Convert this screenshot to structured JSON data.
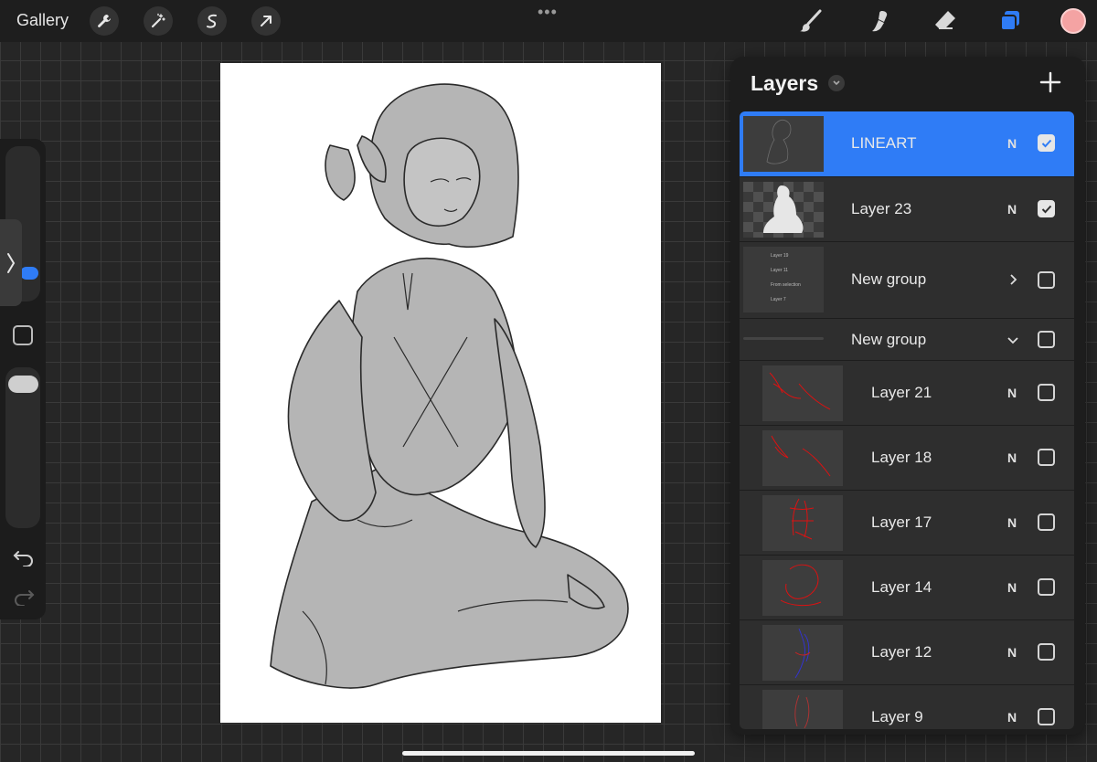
{
  "topbar": {
    "gallery_label": "Gallery",
    "left_tools": [
      "wrench-icon",
      "magic-wand-icon",
      "selection-icon",
      "transform-arrow-icon"
    ],
    "right_tools": [
      "brush-icon",
      "smudge-icon",
      "eraser-icon",
      "layers-icon"
    ],
    "color_swatch": "#f4a3a3",
    "accent": "#2f7cf6"
  },
  "layers_panel": {
    "title": "Layers",
    "rows": [
      {
        "name": "LINEART",
        "mode": "N",
        "checked": true,
        "selected": true,
        "kind": "layer",
        "indent": false
      },
      {
        "name": "Layer 23",
        "mode": "N",
        "checked": true,
        "selected": false,
        "kind": "layer",
        "indent": false
      },
      {
        "name": "New group",
        "mode": "",
        "checked": false,
        "selected": false,
        "kind": "group-collapsed",
        "indent": false
      },
      {
        "name": "New group",
        "mode": "",
        "checked": false,
        "selected": false,
        "kind": "group-expanded",
        "indent": false
      },
      {
        "name": "Layer 21",
        "mode": "N",
        "checked": false,
        "selected": false,
        "kind": "layer",
        "indent": true
      },
      {
        "name": "Layer 18",
        "mode": "N",
        "checked": false,
        "selected": false,
        "kind": "layer",
        "indent": true
      },
      {
        "name": "Layer 17",
        "mode": "N",
        "checked": false,
        "selected": false,
        "kind": "layer",
        "indent": true
      },
      {
        "name": "Layer 14",
        "mode": "N",
        "checked": false,
        "selected": false,
        "kind": "layer",
        "indent": true
      },
      {
        "name": "Layer 12",
        "mode": "N",
        "checked": false,
        "selected": false,
        "kind": "layer",
        "indent": true
      },
      {
        "name": "Layer 9",
        "mode": "N",
        "checked": false,
        "selected": false,
        "kind": "layer",
        "indent": true
      }
    ],
    "mini_thumb_labels": [
      "Layer 19",
      "Layer 11",
      "From selection",
      "Layer 7"
    ]
  }
}
